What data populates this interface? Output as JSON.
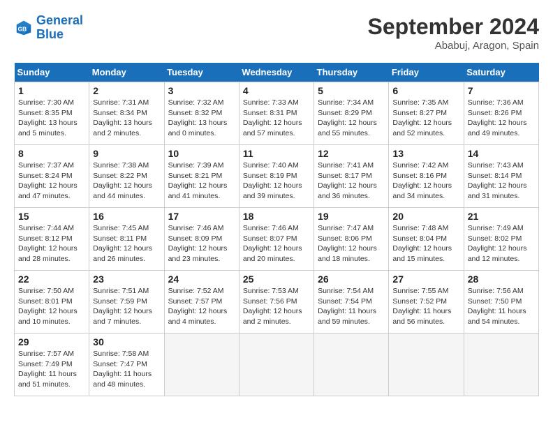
{
  "logo": {
    "line1": "General",
    "line2": "Blue"
  },
  "title": "September 2024",
  "location": "Ababuj, Aragon, Spain",
  "headers": [
    "Sunday",
    "Monday",
    "Tuesday",
    "Wednesday",
    "Thursday",
    "Friday",
    "Saturday"
  ],
  "weeks": [
    [
      {
        "day": 1,
        "sunrise": "7:30 AM",
        "sunset": "8:35 PM",
        "daylight": "13 hours and 5 minutes."
      },
      {
        "day": 2,
        "sunrise": "7:31 AM",
        "sunset": "8:34 PM",
        "daylight": "13 hours and 2 minutes."
      },
      {
        "day": 3,
        "sunrise": "7:32 AM",
        "sunset": "8:32 PM",
        "daylight": "13 hours and 0 minutes."
      },
      {
        "day": 4,
        "sunrise": "7:33 AM",
        "sunset": "8:31 PM",
        "daylight": "12 hours and 57 minutes."
      },
      {
        "day": 5,
        "sunrise": "7:34 AM",
        "sunset": "8:29 PM",
        "daylight": "12 hours and 55 minutes."
      },
      {
        "day": 6,
        "sunrise": "7:35 AM",
        "sunset": "8:27 PM",
        "daylight": "12 hours and 52 minutes."
      },
      {
        "day": 7,
        "sunrise": "7:36 AM",
        "sunset": "8:26 PM",
        "daylight": "12 hours and 49 minutes."
      }
    ],
    [
      {
        "day": 8,
        "sunrise": "7:37 AM",
        "sunset": "8:24 PM",
        "daylight": "12 hours and 47 minutes."
      },
      {
        "day": 9,
        "sunrise": "7:38 AM",
        "sunset": "8:22 PM",
        "daylight": "12 hours and 44 minutes."
      },
      {
        "day": 10,
        "sunrise": "7:39 AM",
        "sunset": "8:21 PM",
        "daylight": "12 hours and 41 minutes."
      },
      {
        "day": 11,
        "sunrise": "7:40 AM",
        "sunset": "8:19 PM",
        "daylight": "12 hours and 39 minutes."
      },
      {
        "day": 12,
        "sunrise": "7:41 AM",
        "sunset": "8:17 PM",
        "daylight": "12 hours and 36 minutes."
      },
      {
        "day": 13,
        "sunrise": "7:42 AM",
        "sunset": "8:16 PM",
        "daylight": "12 hours and 34 minutes."
      },
      {
        "day": 14,
        "sunrise": "7:43 AM",
        "sunset": "8:14 PM",
        "daylight": "12 hours and 31 minutes."
      }
    ],
    [
      {
        "day": 15,
        "sunrise": "7:44 AM",
        "sunset": "8:12 PM",
        "daylight": "12 hours and 28 minutes."
      },
      {
        "day": 16,
        "sunrise": "7:45 AM",
        "sunset": "8:11 PM",
        "daylight": "12 hours and 26 minutes."
      },
      {
        "day": 17,
        "sunrise": "7:46 AM",
        "sunset": "8:09 PM",
        "daylight": "12 hours and 23 minutes."
      },
      {
        "day": 18,
        "sunrise": "7:46 AM",
        "sunset": "8:07 PM",
        "daylight": "12 hours and 20 minutes."
      },
      {
        "day": 19,
        "sunrise": "7:47 AM",
        "sunset": "8:06 PM",
        "daylight": "12 hours and 18 minutes."
      },
      {
        "day": 20,
        "sunrise": "7:48 AM",
        "sunset": "8:04 PM",
        "daylight": "12 hours and 15 minutes."
      },
      {
        "day": 21,
        "sunrise": "7:49 AM",
        "sunset": "8:02 PM",
        "daylight": "12 hours and 12 minutes."
      }
    ],
    [
      {
        "day": 22,
        "sunrise": "7:50 AM",
        "sunset": "8:01 PM",
        "daylight": "12 hours and 10 minutes."
      },
      {
        "day": 23,
        "sunrise": "7:51 AM",
        "sunset": "7:59 PM",
        "daylight": "12 hours and 7 minutes."
      },
      {
        "day": 24,
        "sunrise": "7:52 AM",
        "sunset": "7:57 PM",
        "daylight": "12 hours and 4 minutes."
      },
      {
        "day": 25,
        "sunrise": "7:53 AM",
        "sunset": "7:56 PM",
        "daylight": "12 hours and 2 minutes."
      },
      {
        "day": 26,
        "sunrise": "7:54 AM",
        "sunset": "7:54 PM",
        "daylight": "11 hours and 59 minutes."
      },
      {
        "day": 27,
        "sunrise": "7:55 AM",
        "sunset": "7:52 PM",
        "daylight": "11 hours and 56 minutes."
      },
      {
        "day": 28,
        "sunrise": "7:56 AM",
        "sunset": "7:50 PM",
        "daylight": "11 hours and 54 minutes."
      }
    ],
    [
      {
        "day": 29,
        "sunrise": "7:57 AM",
        "sunset": "7:49 PM",
        "daylight": "11 hours and 51 minutes."
      },
      {
        "day": 30,
        "sunrise": "7:58 AM",
        "sunset": "7:47 PM",
        "daylight": "11 hours and 48 minutes."
      },
      null,
      null,
      null,
      null,
      null
    ]
  ]
}
